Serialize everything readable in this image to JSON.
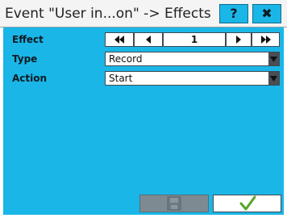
{
  "window": {
    "title": "Event \"User in...on\" -> Effects",
    "help_label": "?",
    "close_label": "✖"
  },
  "form": {
    "effect": {
      "label": "Effect",
      "value": "1"
    },
    "type": {
      "label": "Type",
      "value": "Record"
    },
    "action": {
      "label": "Action",
      "value": "Start"
    }
  },
  "colors": {
    "accent": "#1ab6e7",
    "ok": "#58a629",
    "disabled": "#7e8a92"
  },
  "icons": {
    "first": "double-left-triangle",
    "prev": "left-triangle",
    "next": "right-triangle",
    "last": "double-right-triangle",
    "dropdown": "down-triangle",
    "save": "floppy-disk",
    "ok": "check-mark"
  }
}
